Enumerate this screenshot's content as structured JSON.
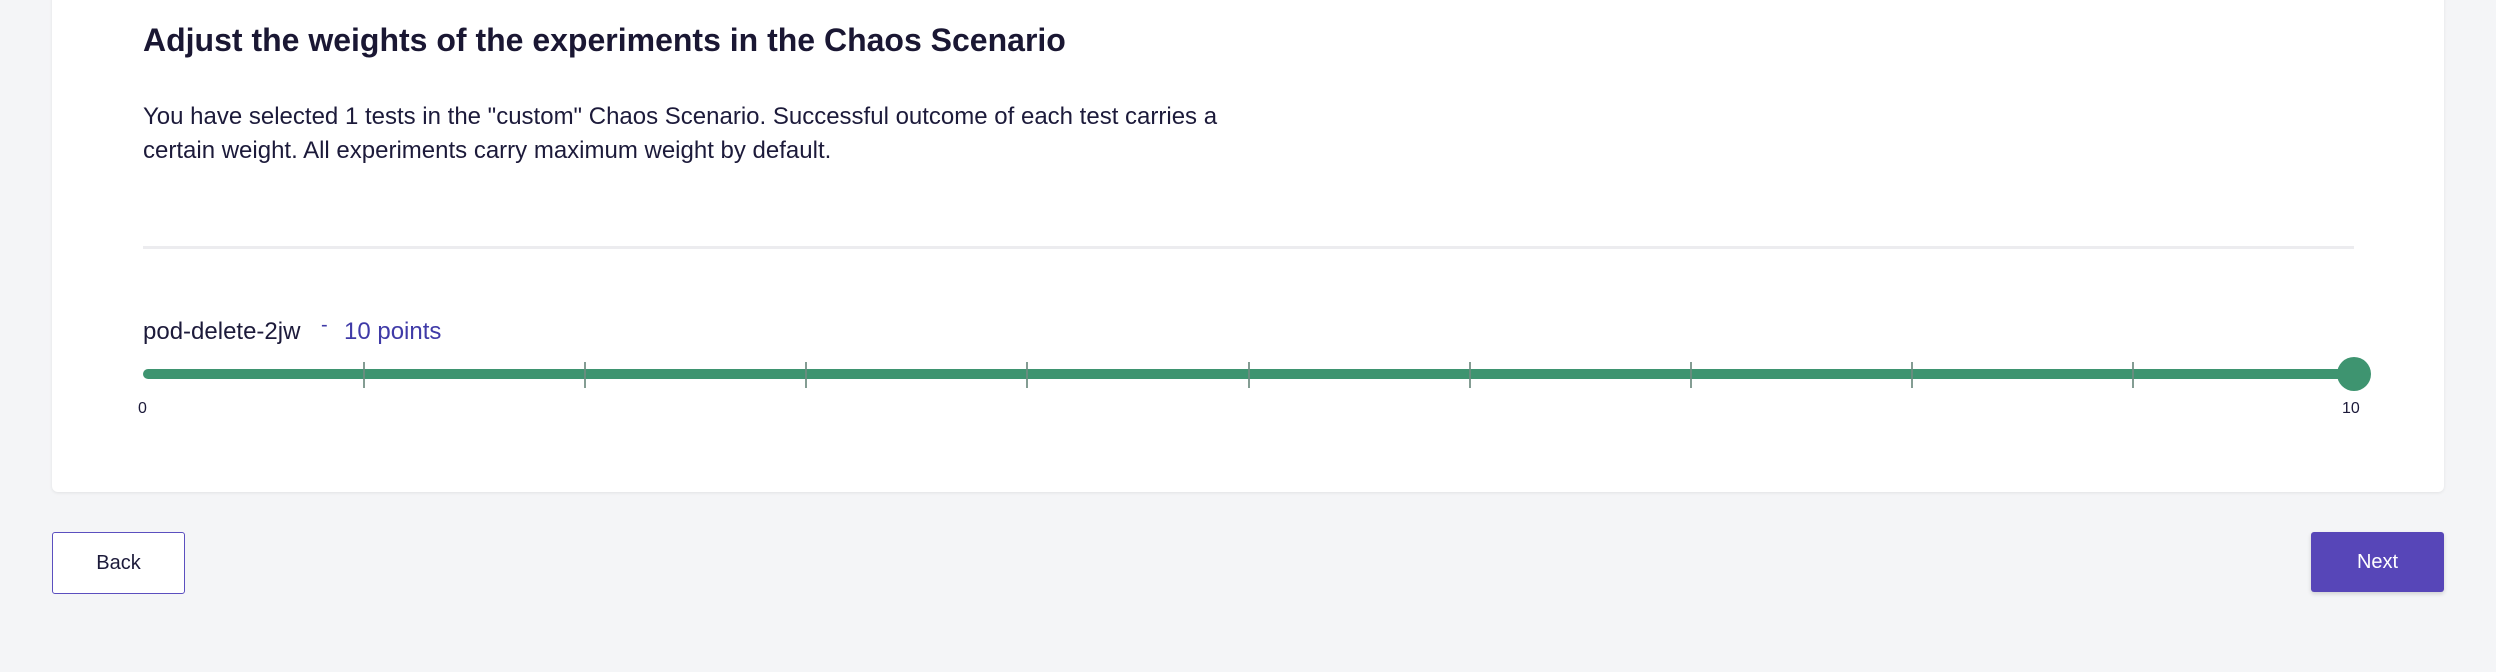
{
  "page": {
    "title": "Adjust the weights of the experiments in the Chaos Scenario",
    "description": "You have selected 1 tests in the \"custom\" Chaos Scenario. Successful outcome of each test carries a certain weight. All experiments carry maximum weight by default."
  },
  "experiments": [
    {
      "name": "pod-delete-2jw",
      "separator": "-",
      "points_label": "10 points",
      "weight": 10,
      "min_label": "0",
      "max_label": "10",
      "min": 0,
      "max": 10,
      "step": 1
    }
  ],
  "buttons": {
    "back_label": "Back",
    "next_label": "Next"
  },
  "colors": {
    "slider_green": "#3e9470",
    "accent_purple": "#5746b8",
    "points_text": "#3f3aa7"
  }
}
